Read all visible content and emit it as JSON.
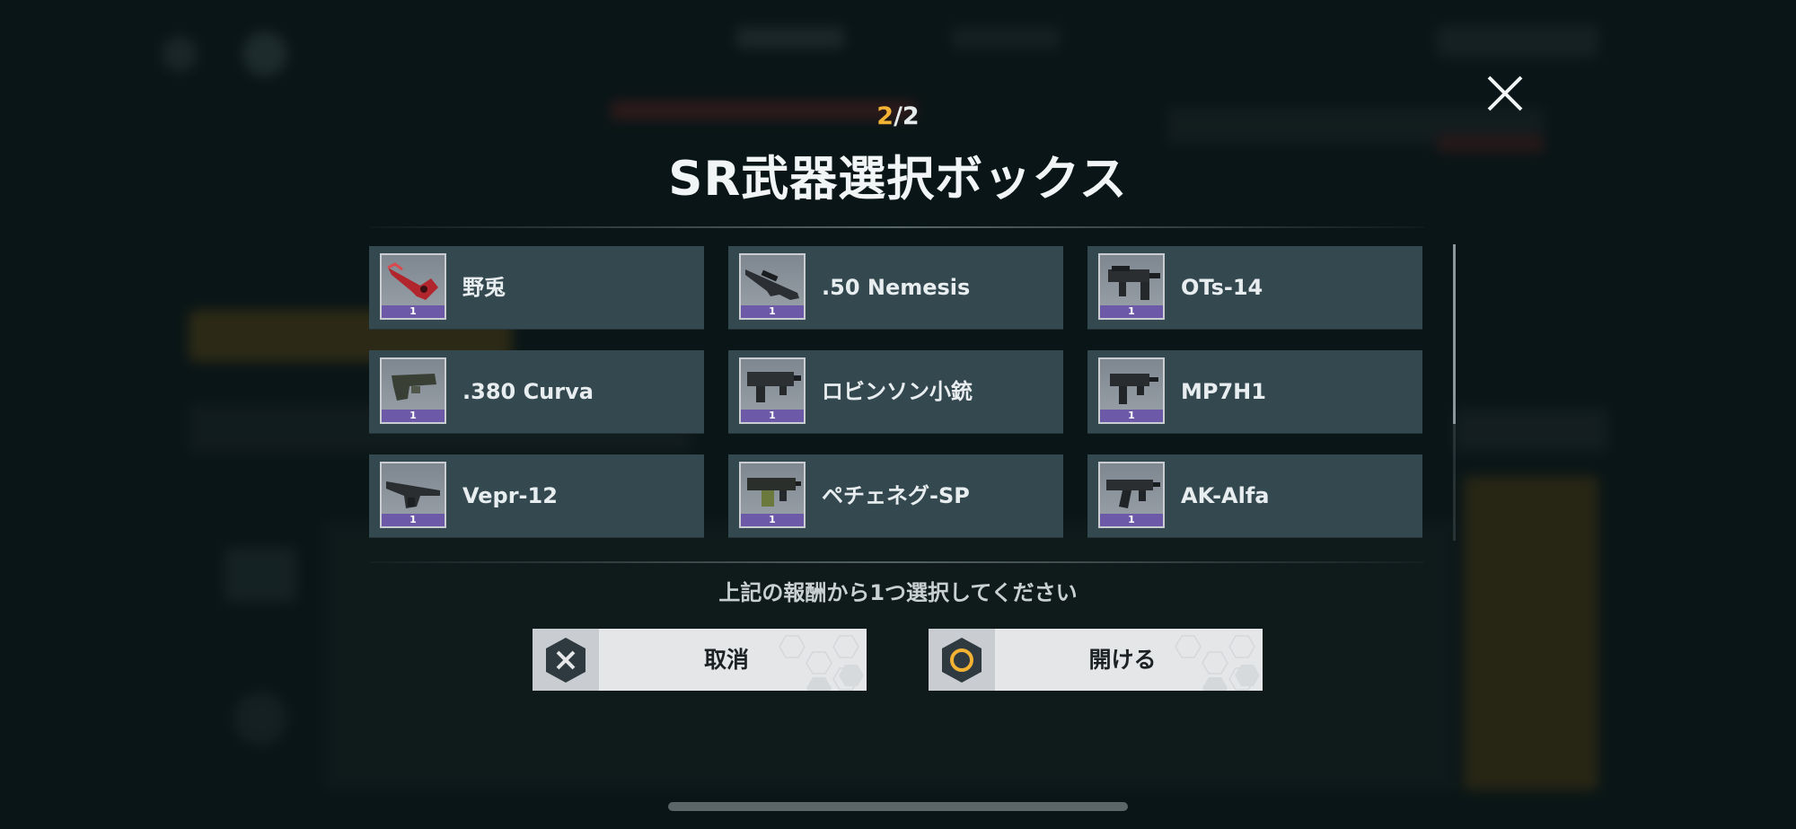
{
  "dialog": {
    "counter_current": "2",
    "counter_total": "/2",
    "title": "SR武器選択ボックス",
    "instruction": "上記の報酬から1つ選択してください"
  },
  "items": [
    {
      "name": "野兎",
      "qty": "1",
      "icon": "red-pistol-icon"
    },
    {
      "name": ".50 Nemesis",
      "qty": "1",
      "icon": "sniper-rifle-icon"
    },
    {
      "name": "OTs-14",
      "qty": "1",
      "icon": "assault-rifle-icon"
    },
    {
      "name": ".380 Curva",
      "qty": "1",
      "icon": "pistol-icon"
    },
    {
      "name": "ロビンソン小銃",
      "qty": "1",
      "icon": "carbine-icon"
    },
    {
      "name": "MP7H1",
      "qty": "1",
      "icon": "smg-icon"
    },
    {
      "name": "Vepr-12",
      "qty": "1",
      "icon": "shotgun-icon"
    },
    {
      "name": "ペチェネグ-SP",
      "qty": "1",
      "icon": "machine-gun-icon"
    },
    {
      "name": "AK-Alfa",
      "qty": "1",
      "icon": "ak-rifle-icon"
    }
  ],
  "buttons": {
    "cancel": {
      "label": "取消",
      "icon": "x-circle-icon"
    },
    "open": {
      "label": "開ける",
      "icon": "o-circle-icon"
    }
  },
  "colors": {
    "accent": "#f2b233",
    "item_bg": "#344850",
    "rarity_bar": "#6c5aa8",
    "button_bg": "#e4e6e8"
  }
}
